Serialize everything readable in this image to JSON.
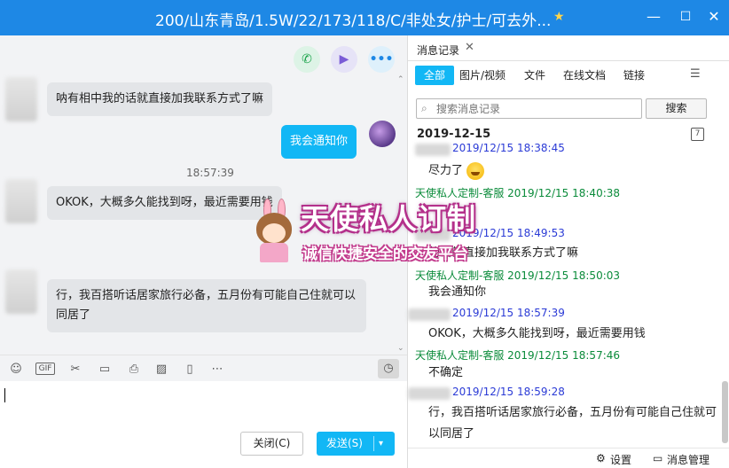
{
  "window": {
    "title": "200/山东青岛/1.5W/22/173/118/C/非处女/护士/可去外...",
    "minimize": "—",
    "maximize": "☐",
    "close": "✕"
  },
  "chat": {
    "messages": [
      {
        "side": "left",
        "text": "呐有相中我的话就直接加我联系方式了嘛"
      },
      {
        "side": "right",
        "text": "我会通知你"
      },
      {
        "side": "left",
        "text": "OKOK，大概多久能找到呀，最近需要用钱"
      },
      {
        "side": "left",
        "text": "行，我百搭听话居家旅行必备，五月份有可能自己住就可以同居了"
      }
    ],
    "timestamp": "18:57:39",
    "toolbar": {
      "gif": "GIF"
    },
    "buttons": {
      "close": "关闭(C)",
      "send": "发送(S)"
    }
  },
  "history": {
    "tab": "消息记录",
    "filters": [
      "全部",
      "图片/视频",
      "文件",
      "在线文档",
      "链接"
    ],
    "search_placeholder": "搜索消息记录",
    "search_button": "搜索",
    "date": "2019-12-15",
    "entries": [
      {
        "meta": "2019/12/15 18:38:45",
        "color": "blue",
        "text": "尽力了"
      },
      {
        "meta": "天使私人定制-客服 2019/12/15 18:40:38",
        "color": "green",
        "text": ""
      },
      {
        "meta": "2019/12/15 18:49:53",
        "color": "blue",
        "text": "的话就直接加我联系方式了嘛"
      },
      {
        "meta": "天使私人定制-客服 2019/12/15 18:50:03",
        "color": "green",
        "text": "我会通知你"
      },
      {
        "meta": "2019/12/15 18:57:39",
        "color": "blue",
        "text": "OKOK，大概多久能找到呀，最近需要用钱"
      },
      {
        "meta": "天使私人定制-客服 2019/12/15 18:57:46",
        "color": "green",
        "text": "不确定"
      },
      {
        "meta": "2019/12/15 18:59:28",
        "color": "blue",
        "text": "行，我百搭听话居家旅行必备，五月份有可能自己住就可"
      },
      {
        "meta": "",
        "color": "blue",
        "text": "以同居了"
      }
    ],
    "footer": {
      "settings": "设置",
      "manage": "消息管理"
    }
  },
  "watermark": {
    "title": "天使私人订制",
    "subtitle": "诚信快捷安全的交友平台"
  },
  "colors": {
    "titlebar": "#1e88e5",
    "accent": "#12b7f5",
    "green_meta": "#0a8b3a",
    "blue_meta": "#2b3bd6"
  }
}
